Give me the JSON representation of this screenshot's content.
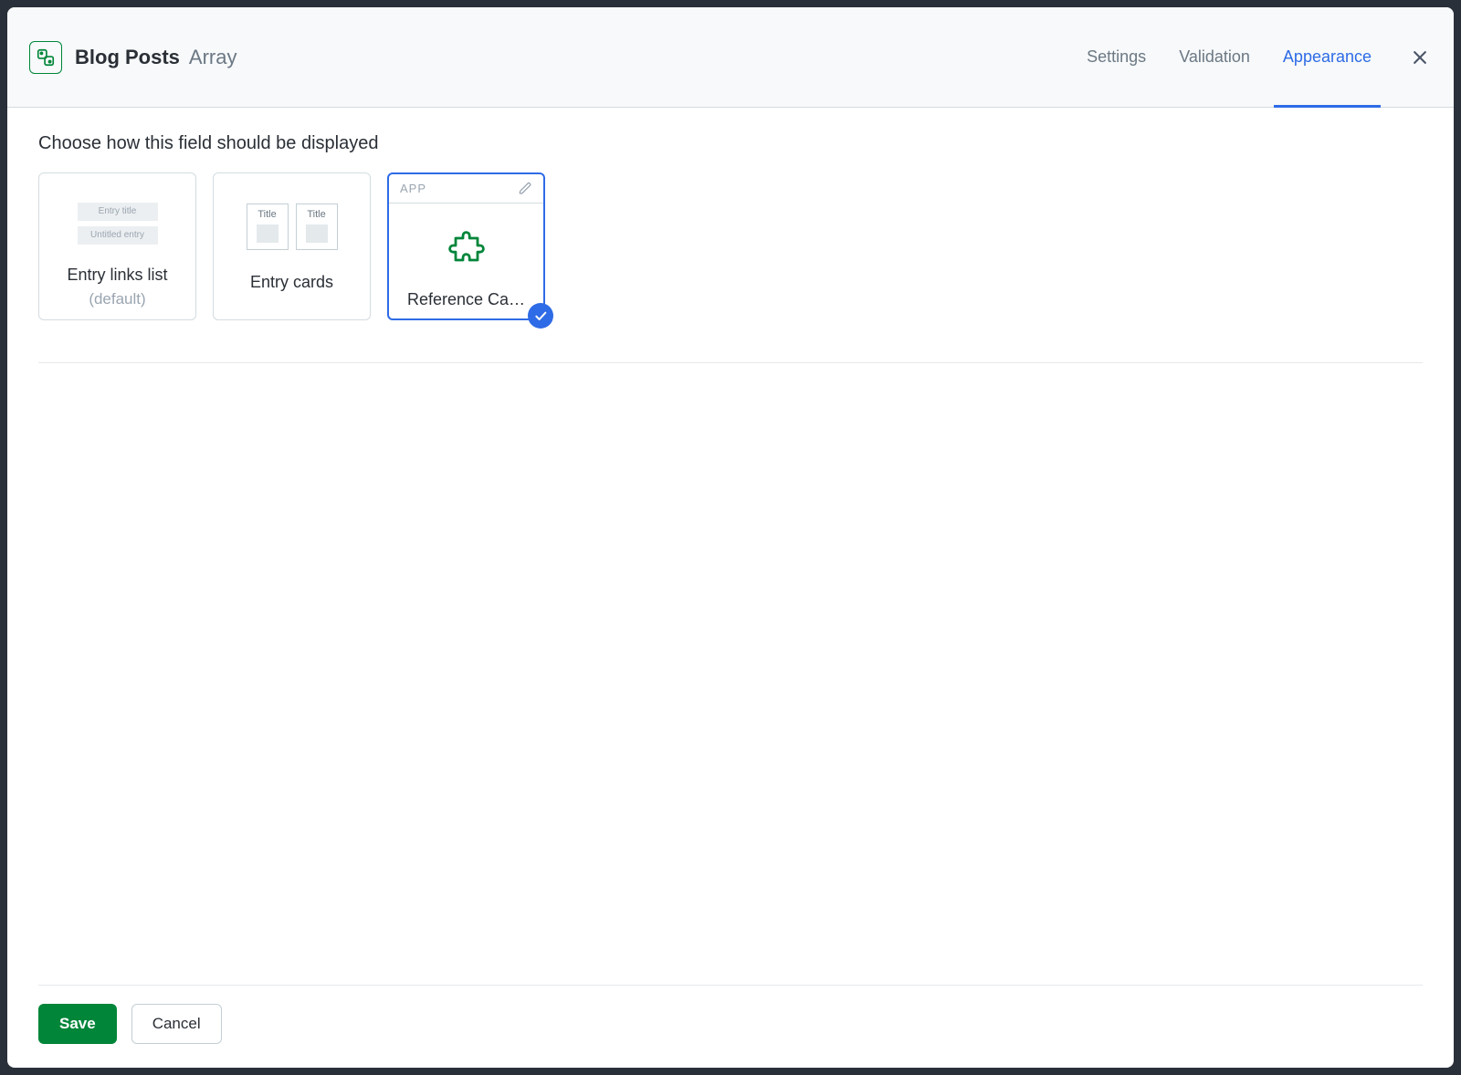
{
  "header": {
    "title": "Blog Posts",
    "type": "Array",
    "tabs": {
      "settings": "Settings",
      "validation": "Validation",
      "appearance": "Appearance"
    }
  },
  "body": {
    "section_title": "Choose how this field should be displayed",
    "options": {
      "entry_links": {
        "label": "Entry links list",
        "sub": "(default)",
        "preview_lines": {
          "a": "Entry title",
          "b": "Untitled entry"
        }
      },
      "entry_cards": {
        "label": "Entry cards",
        "preview_title": "Title"
      },
      "app_card": {
        "badge": "APP",
        "label": "Reference Ca…"
      }
    }
  },
  "footer": {
    "save": "Save",
    "cancel": "Cancel"
  }
}
